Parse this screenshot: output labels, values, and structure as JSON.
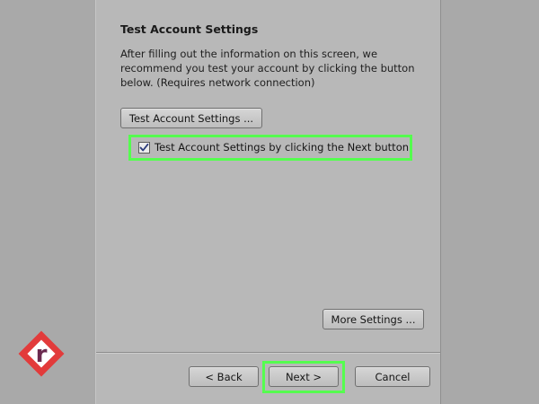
{
  "section": {
    "title": "Test Account Settings",
    "description": "After filling out the information on this screen, we recommend you test your account by clicking the button below. (Requires network connection)"
  },
  "buttons": {
    "test_account": "Test Account Settings ...",
    "more_settings": "More Settings ...",
    "back": "< Back",
    "next": "Next >",
    "cancel": "Cancel"
  },
  "checkbox": {
    "label": "Test Account Settings by clicking the Next button",
    "checked": true
  },
  "logo": {
    "letter": "r",
    "icon": "brand-logo-icon"
  },
  "colors": {
    "highlight": "#55ff4f",
    "logo_red": "#e23b3b",
    "logo_purple": "#6b2a4f"
  }
}
